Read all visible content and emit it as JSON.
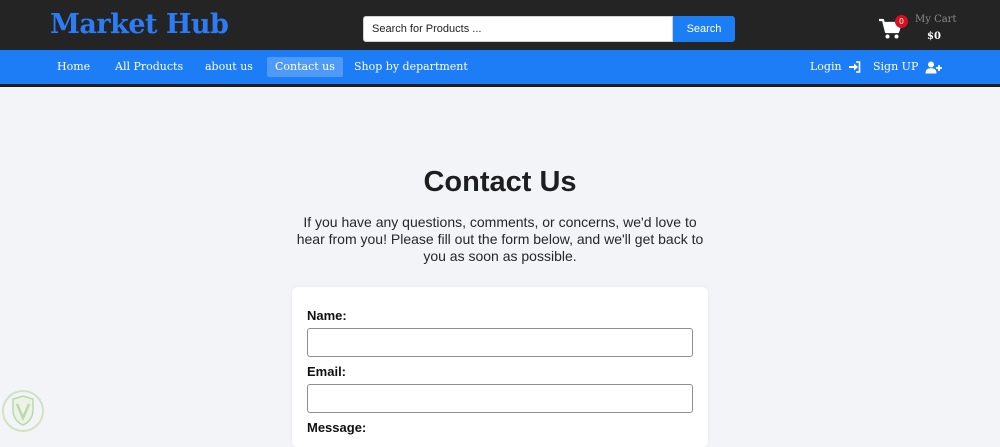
{
  "header": {
    "logo": "Market Hub",
    "search": {
      "placeholder": "Search for Products ...",
      "value": "",
      "button_label": "Search"
    },
    "cart": {
      "count": "0",
      "label": "My Cart",
      "total": "$0"
    }
  },
  "nav": {
    "links": [
      "Home",
      "All Products",
      "about us",
      "Contact us",
      "Shop by department"
    ],
    "active": "Contact us",
    "login_label": "Login",
    "signup_label": "Sign UP"
  },
  "main": {
    "title": "Contact Us",
    "intro": "If you have any questions, comments, or concerns, we'd love to hear from you! Please fill out the form below, and we'll get back to you as soon as possible.",
    "form": {
      "name_label": "Name:",
      "name_value": "",
      "email_label": "Email:",
      "email_value": "",
      "message_label": "Message:"
    }
  },
  "colors": {
    "brand_blue": "#1d7df6",
    "topbar": "#242424",
    "badge_red": "#d90f1e",
    "page_bg": "#f3f4f8"
  }
}
